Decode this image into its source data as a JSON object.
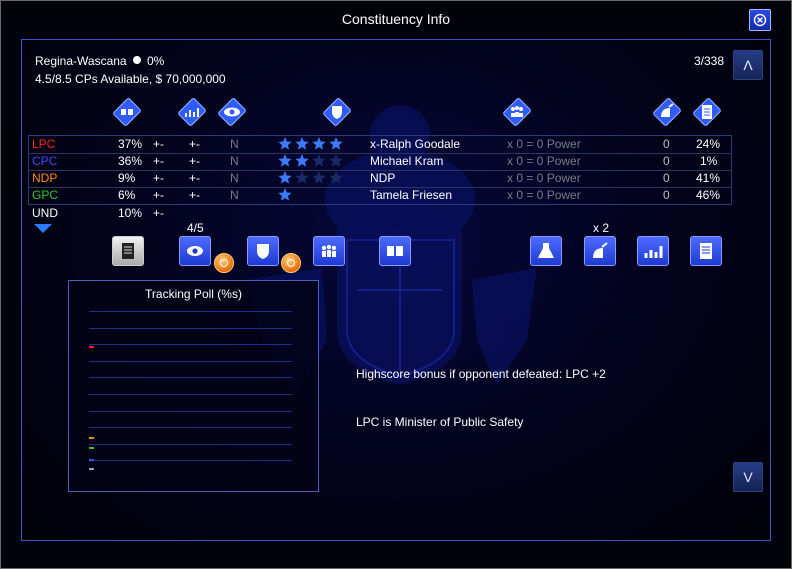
{
  "window": {
    "title": "Constituency Info"
  },
  "constituency": {
    "name": "Regina-Wascana",
    "pct": "0%",
    "cps_line": "4.5/8.5 CPs Available, $ 70,000,000",
    "counter": "3/338"
  },
  "nav": {
    "up_label": "Λ",
    "down_label": "V"
  },
  "header_icons": [
    "debate-icon",
    "polling-icon",
    "eye-icon",
    "shield-icon",
    "team-icon",
    "satellite-icon",
    "document-icon"
  ],
  "parties": [
    {
      "abbr": "LPC",
      "color": "#ff2020",
      "pct": "37%",
      "c1": "+-",
      "c2": "+-",
      "n": "N",
      "stars": 4,
      "stars_total": 4,
      "candidate": "x-Ralph Goodale",
      "power": "x 0 = 0 Power",
      "zero": "0",
      "right_pct": "24%"
    },
    {
      "abbr": "CPC",
      "color": "#3a4cff",
      "pct": "36%",
      "c1": "+-",
      "c2": "+-",
      "n": "N",
      "stars": 2,
      "stars_total": 4,
      "candidate": "Michael Kram",
      "power": "x 0 = 0 Power",
      "zero": "0",
      "right_pct": "1%"
    },
    {
      "abbr": "NDP",
      "color": "#ff8a1a",
      "pct": "9%",
      "c1": "+-",
      "c2": "+-",
      "n": "N",
      "stars": 1,
      "stars_total": 4,
      "candidate": "NDP",
      "power": "x 0 = 0 Power",
      "zero": "0",
      "right_pct": "41%"
    },
    {
      "abbr": "GPC",
      "color": "#2ec82e",
      "pct": "6%",
      "c1": "+-",
      "c2": "+-",
      "n": "N",
      "stars": 1,
      "stars_total": 1,
      "candidate": "Tamela Friesen",
      "power": "x 0 = 0 Power",
      "zero": "0",
      "right_pct": "46%"
    },
    {
      "abbr": "UND",
      "color": "#ffffff",
      "pct": "10%",
      "c1": "+-"
    }
  ],
  "actions": {
    "counter_label": "4/5",
    "multiplier_label": "x 2",
    "buttons": [
      "scroll-icon",
      "eye-icon",
      "shield-icon",
      "team-icon",
      "debate-icon",
      "flask-icon",
      "satellite-icon",
      "polling-icon",
      "document-icon"
    ]
  },
  "poll": {
    "title": "Tracking Poll (%s)",
    "line_count": 10,
    "party_colors": [
      "#ff2020",
      "#ff8a1a",
      "#2ec82e",
      "#3a4cff",
      "#9aa0c0"
    ]
  },
  "notes": {
    "highscore": "Highscore bonus if opponent defeated: LPC +2",
    "minister": "LPC is Minister of Public Safety"
  },
  "colors": {
    "accent": "#2b4be0",
    "panel_border": "#3a55c8",
    "star": "#3a7bff"
  }
}
